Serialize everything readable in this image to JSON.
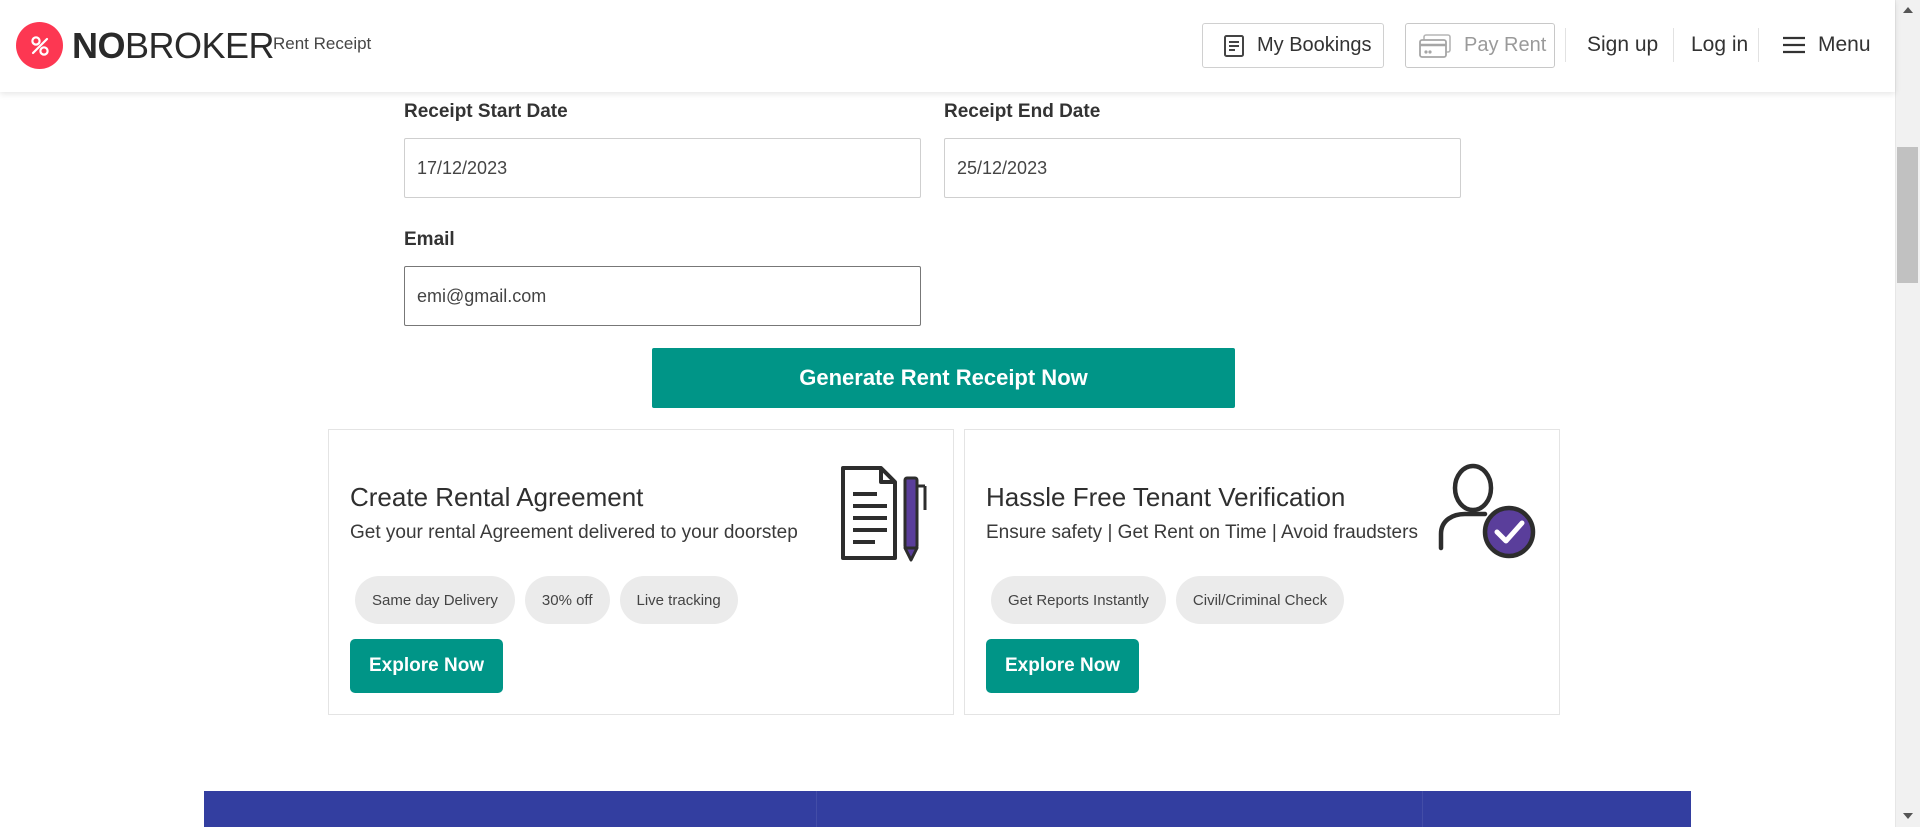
{
  "header": {
    "brand_no": "NO",
    "brand_broker": "BROKER",
    "subtitle": "Rent Receipt",
    "bookings_label": "My Bookings",
    "payrent_label": "Pay Rent",
    "signup_label": "Sign up",
    "login_label": "Log in",
    "menu_label": "Menu"
  },
  "form": {
    "start_date_label": "Receipt Start Date",
    "start_date_value": "17/12/2023",
    "end_date_label": "Receipt End Date",
    "end_date_value": "25/12/2023",
    "email_label": "Email",
    "email_value": "emi@gmail.com",
    "generate_label": "Generate Rent Receipt Now"
  },
  "cards": {
    "agreement": {
      "title": "Create Rental Agreement",
      "desc": "Get your rental Agreement delivered to your doorstep",
      "chips": [
        "Same day Delivery",
        "30% off",
        "Live tracking"
      ],
      "cta": "Explore Now"
    },
    "verification": {
      "title": "Hassle Free Tenant Verification",
      "desc": "Ensure safety | Get Rent on Time | Avoid fraudsters",
      "chips": [
        "Get Reports Instantly",
        "Civil/Criminal Check"
      ],
      "cta": "Explore Now"
    }
  },
  "colors": {
    "brand_red": "#fd3752",
    "teal": "#009587",
    "band_blue": "#333ea0",
    "purple": "#5a3e9b"
  },
  "icons": {
    "logo": "nobroker-logo-icon",
    "bookings": "bookings-icon",
    "payrent": "card-icon",
    "menu": "hamburger-icon",
    "agreement": "document-pen-icon",
    "verification": "user-check-icon"
  }
}
